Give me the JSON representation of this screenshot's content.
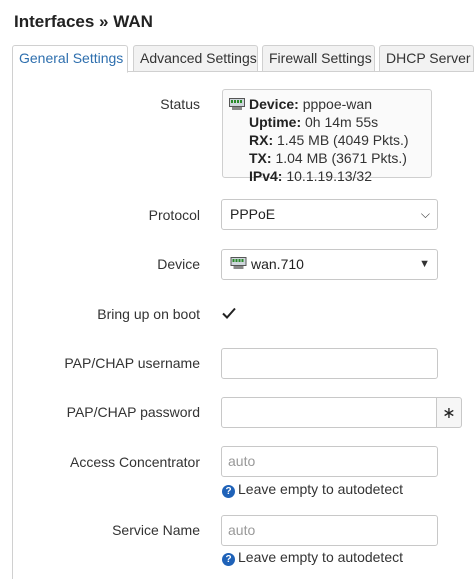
{
  "page": {
    "title": "Interfaces » WAN"
  },
  "tabs": [
    {
      "label": "General Settings",
      "active": true
    },
    {
      "label": "Advanced Settings",
      "active": false
    },
    {
      "label": "Firewall Settings",
      "active": false
    },
    {
      "label": "DHCP Server",
      "active": false
    }
  ],
  "status": {
    "label": "Status",
    "device_key": "Device:",
    "device_val": "pppoe-wan",
    "uptime_key": "Uptime:",
    "uptime_val": "0h 14m 55s",
    "rx_key": "RX:",
    "rx_val": "1.45 MB (4049 Pkts.)",
    "tx_key": "TX:",
    "tx_val": "1.04 MB (3671 Pkts.)",
    "ipv4_key": "IPv4:",
    "ipv4_val": "10.1.19.13/32"
  },
  "protocol": {
    "label": "Protocol",
    "value": "PPPoE"
  },
  "device": {
    "label": "Device",
    "value": "wan.710"
  },
  "boot": {
    "label": "Bring up on boot",
    "checked": true
  },
  "username": {
    "label": "PAP/CHAP username",
    "value": ""
  },
  "password": {
    "label": "PAP/CHAP password",
    "value": "",
    "reveal": "∗"
  },
  "ac": {
    "label": "Access Concentrator",
    "placeholder": "auto",
    "hint": "Leave empty to autodetect"
  },
  "service": {
    "label": "Service Name",
    "placeholder": "auto",
    "hint": "Leave empty to autodetect"
  },
  "colors": {
    "accent": "#2e6fae",
    "help": "#1f62b8"
  }
}
